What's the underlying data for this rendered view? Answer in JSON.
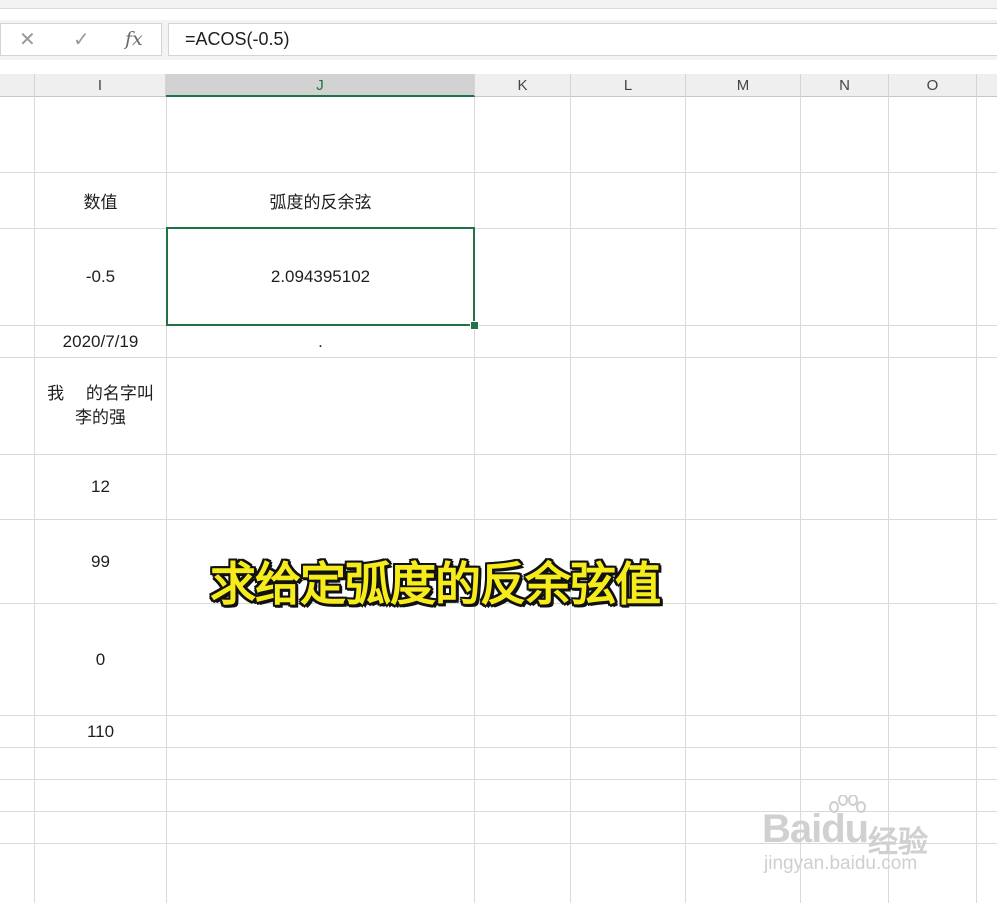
{
  "formula_bar": {
    "cancel_icon": "✕",
    "enter_icon": "✓",
    "fx_label": "fx",
    "formula": "=ACOS(-0.5)"
  },
  "columns": [
    {
      "id": "I",
      "label": "I",
      "selected": false
    },
    {
      "id": "J",
      "label": "J",
      "selected": true
    },
    {
      "id": "K",
      "label": "K",
      "selected": false
    },
    {
      "id": "L",
      "label": "L",
      "selected": false
    },
    {
      "id": "M",
      "label": "M",
      "selected": false
    },
    {
      "id": "N",
      "label": "N",
      "selected": false
    },
    {
      "id": "O",
      "label": "O",
      "selected": false
    }
  ],
  "cells": {
    "header_value": "数值",
    "header_result": "弧度的反余弦",
    "value_1": "-0.5",
    "result_1": "2.094395102",
    "value_date": "2020/7/19",
    "result_dot": ".",
    "value_text_line1": "我　 的名字叫",
    "value_text_line2": "李的强",
    "value_12": "12",
    "value_99": "99",
    "value_0": "0",
    "value_110": "110"
  },
  "overlay_caption": "求给定弧度的反余弦值",
  "watermark": {
    "logo": "Baidu",
    "product": "经验",
    "url": "jingyan.baidu.com"
  },
  "colors": {
    "selection": "#217346",
    "caption": "#f7ec1b"
  }
}
